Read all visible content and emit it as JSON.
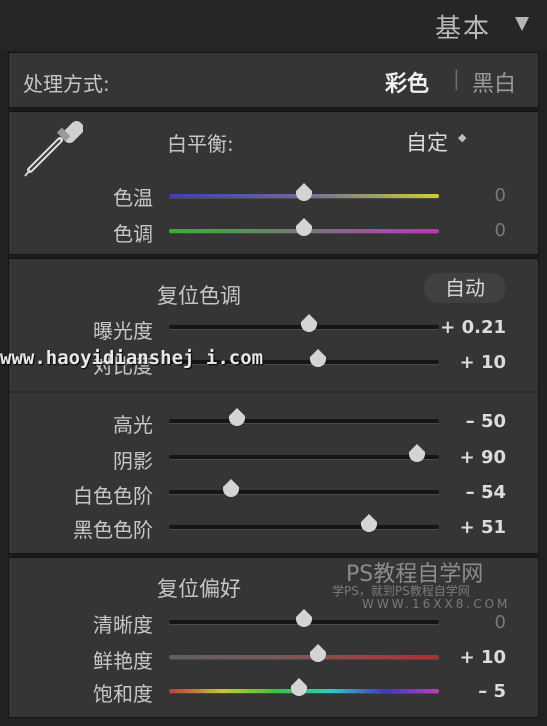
{
  "header": {
    "title": "基本"
  },
  "treatment": {
    "label": "处理方式:",
    "color": "彩色",
    "bw": "黑白",
    "separator": "|"
  },
  "wb": {
    "label": "白平衡:",
    "preset": "自定",
    "preset_arrows": "◆",
    "temp": {
      "label": "色温",
      "value": "0",
      "level": 0.5
    },
    "tint": {
      "label": "色调",
      "value": "0",
      "level": 0.5
    }
  },
  "tone": {
    "reset_label": "复位色调",
    "auto_label": "自动",
    "exposure": {
      "label": "曝光度",
      "value": "+ 0.21",
      "level": 0.52
    },
    "contrast": {
      "label": "对比度",
      "value": "+ 10",
      "level": 0.55
    },
    "highlights": {
      "label": "高光",
      "value": "– 50",
      "level": 0.25
    },
    "shadows": {
      "label": "阴影",
      "value": "+ 90",
      "level": 0.92
    },
    "whites": {
      "label": "白色色阶",
      "value": "– 54",
      "level": 0.23
    },
    "blacks": {
      "label": "黑色色阶",
      "value": "+ 51",
      "level": 0.74
    }
  },
  "presence": {
    "reset_label": "复位偏好",
    "clarity": {
      "label": "清晰度",
      "value": "0",
      "level": 0.5
    },
    "vibrance": {
      "label": "鲜艳度",
      "value": "+ 10",
      "level": 0.55
    },
    "saturation": {
      "label": "饱和度",
      "value": "– 5",
      "level": 0.48
    }
  },
  "watermarks": {
    "site": "www.haoyidianshej i.com",
    "ps_title": "PS教程自学网",
    "ps_sub": "学PS，就到PS教程自学网",
    "ps_url": "WWW.16XX8.COM"
  }
}
